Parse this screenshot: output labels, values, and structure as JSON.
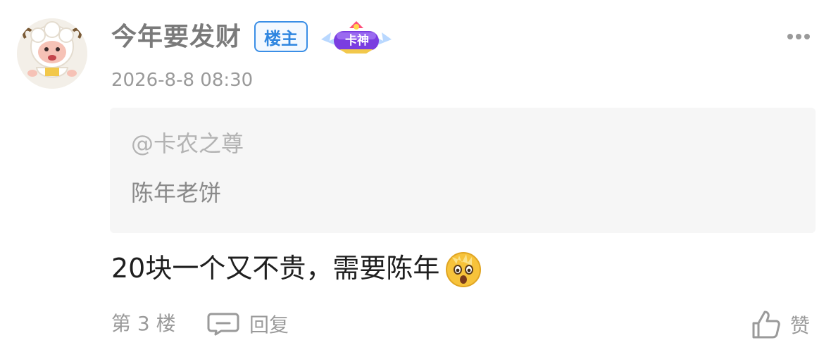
{
  "post": {
    "username": "今年要发财",
    "op_badge": "楼主",
    "rank_badge": "卡神",
    "timestamp": "2026-8-8 08:30",
    "quote": {
      "author": "@卡农之尊",
      "text": "陈年老饼"
    },
    "body": "20块一个又不贵，需要陈年",
    "body_emoji": "surprised-face-emoji",
    "floor_label": "第 3 楼",
    "reply_label": "回复",
    "like_label": "赞"
  },
  "icons": {
    "more": "more-dots-icon",
    "reply": "comment-icon",
    "like": "thumbs-up-icon"
  },
  "colors": {
    "op_badge": "#2f86e0",
    "quote_bg": "#f6f6f6",
    "text_secondary": "#9a9a9a"
  }
}
